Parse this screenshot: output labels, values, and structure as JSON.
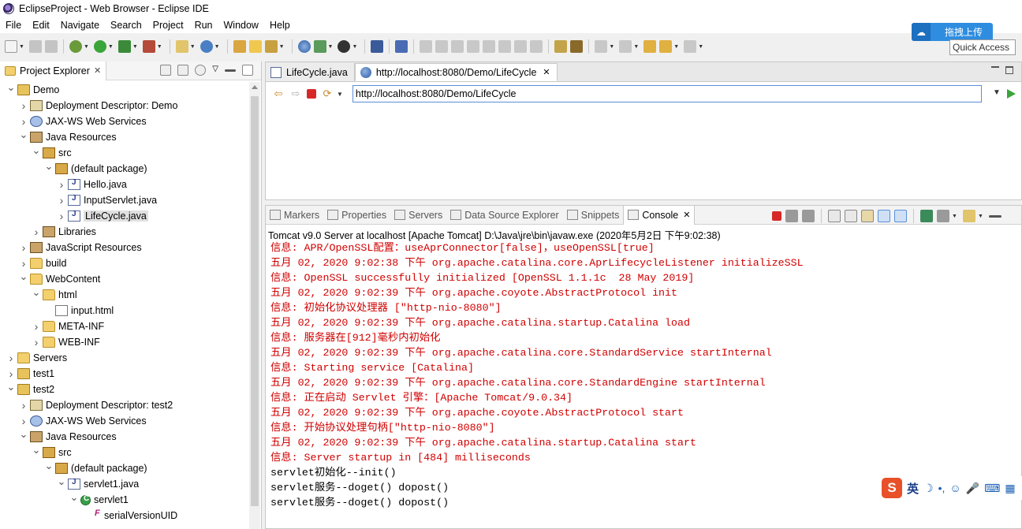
{
  "window": {
    "title": "EclipseProject - Web Browser - Eclipse IDE"
  },
  "menu": [
    "File",
    "Edit",
    "Navigate",
    "Search",
    "Project",
    "Run",
    "Window",
    "Help"
  ],
  "upload": {
    "label": "拖拽上传"
  },
  "quick_access": {
    "label": "Quick Access"
  },
  "project_explorer": {
    "tab_label": "Project Explorer",
    "items": [
      {
        "label": "Demo",
        "depth": 0,
        "arrow": "open",
        "icon": "project"
      },
      {
        "label": "Deployment Descriptor: Demo",
        "depth": 1,
        "arrow": "closed",
        "icon": "dd"
      },
      {
        "label": "JAX-WS Web Services",
        "depth": 1,
        "arrow": "closed",
        "icon": "ws"
      },
      {
        "label": "Java Resources",
        "depth": 1,
        "arrow": "open",
        "icon": "lib"
      },
      {
        "label": "src",
        "depth": 2,
        "arrow": "open",
        "icon": "package"
      },
      {
        "label": "(default package)",
        "depth": 3,
        "arrow": "open",
        "icon": "package"
      },
      {
        "label": "Hello.java",
        "depth": 4,
        "arrow": "closed",
        "icon": "java"
      },
      {
        "label": "InputServlet.java",
        "depth": 4,
        "arrow": "closed",
        "icon": "java"
      },
      {
        "label": "LifeCycle.java",
        "depth": 4,
        "arrow": "closed",
        "icon": "java",
        "selected": true
      },
      {
        "label": "Libraries",
        "depth": 2,
        "arrow": "closed",
        "icon": "lib"
      },
      {
        "label": "JavaScript Resources",
        "depth": 1,
        "arrow": "closed",
        "icon": "lib"
      },
      {
        "label": "build",
        "depth": 1,
        "arrow": "closed",
        "icon": "folder"
      },
      {
        "label": "WebContent",
        "depth": 1,
        "arrow": "open",
        "icon": "folder"
      },
      {
        "label": "html",
        "depth": 2,
        "arrow": "open",
        "icon": "folder"
      },
      {
        "label": "input.html",
        "depth": 3,
        "arrow": "none",
        "icon": "html"
      },
      {
        "label": "META-INF",
        "depth": 2,
        "arrow": "closed",
        "icon": "folder"
      },
      {
        "label": "WEB-INF",
        "depth": 2,
        "arrow": "closed",
        "icon": "folder"
      },
      {
        "label": "Servers",
        "depth": 0,
        "arrow": "closed",
        "icon": "folder"
      },
      {
        "label": "test1",
        "depth": 0,
        "arrow": "closed",
        "icon": "project"
      },
      {
        "label": "test2",
        "depth": 0,
        "arrow": "open",
        "icon": "project"
      },
      {
        "label": "Deployment Descriptor: test2",
        "depth": 1,
        "arrow": "closed",
        "icon": "dd"
      },
      {
        "label": "JAX-WS Web Services",
        "depth": 1,
        "arrow": "closed",
        "icon": "ws"
      },
      {
        "label": "Java Resources",
        "depth": 1,
        "arrow": "open",
        "icon": "lib"
      },
      {
        "label": "src",
        "depth": 2,
        "arrow": "open",
        "icon": "package"
      },
      {
        "label": "(default package)",
        "depth": 3,
        "arrow": "open",
        "icon": "package"
      },
      {
        "label": "servlet1.java",
        "depth": 4,
        "arrow": "open",
        "icon": "java"
      },
      {
        "label": "servlet1",
        "depth": 5,
        "arrow": "open",
        "icon": "classc"
      },
      {
        "label": "serialVersionUID",
        "depth": 6,
        "arrow": "none",
        "icon": "field"
      }
    ]
  },
  "editor": {
    "tabs": [
      {
        "label": "LifeCycle.java",
        "icon": "jfile",
        "active": false
      },
      {
        "label": "http://localhost:8080/Demo/LifeCycle",
        "icon": "globe",
        "active": true
      }
    ],
    "url": "http://localhost:8080/Demo/LifeCycle"
  },
  "console": {
    "tabs": [
      {
        "label": "Markers",
        "active": false
      },
      {
        "label": "Properties",
        "active": false
      },
      {
        "label": "Servers",
        "active": false
      },
      {
        "label": "Data Source Explorer",
        "active": false
      },
      {
        "label": "Snippets",
        "active": false
      },
      {
        "label": "Console",
        "active": true
      }
    ],
    "description": "Tomcat v9.0 Server at localhost [Apache Tomcat] D:\\Java\\jre\\bin\\javaw.exe (2020年5月2日 下午9:02:38)",
    "lines": [
      {
        "text": "信息: APR/OpenSSL配置：useAprConnector[false]，useOpenSSL[true]",
        "kind": "err"
      },
      {
        "text": "五月 02, 2020 9:02:38 下午 org.apache.catalina.core.AprLifecycleListener initializeSSL",
        "kind": "err"
      },
      {
        "text": "信息: OpenSSL successfully initialized [OpenSSL 1.1.1c  28 May 2019]",
        "kind": "err"
      },
      {
        "text": "五月 02, 2020 9:02:39 下午 org.apache.coyote.AbstractProtocol init",
        "kind": "err"
      },
      {
        "text": "信息: 初始化协议处理器 [\"http-nio-8080\"]",
        "kind": "err"
      },
      {
        "text": "五月 02, 2020 9:02:39 下午 org.apache.catalina.startup.Catalina load",
        "kind": "err"
      },
      {
        "text": "信息: 服务器在[912]毫秒内初始化",
        "kind": "err"
      },
      {
        "text": "五月 02, 2020 9:02:39 下午 org.apache.catalina.core.StandardService startInternal",
        "kind": "err"
      },
      {
        "text": "信息: Starting service [Catalina]",
        "kind": "err"
      },
      {
        "text": "五月 02, 2020 9:02:39 下午 org.apache.catalina.core.StandardEngine startInternal",
        "kind": "err"
      },
      {
        "text": "信息: 正在启动 Servlet 引擎：[Apache Tomcat/9.0.34]",
        "kind": "err"
      },
      {
        "text": "五月 02, 2020 9:02:39 下午 org.apache.coyote.AbstractProtocol start",
        "kind": "err"
      },
      {
        "text": "信息: 开始协议处理句柄[\"http-nio-8080\"]",
        "kind": "err"
      },
      {
        "text": "五月 02, 2020 9:02:39 下午 org.apache.catalina.startup.Catalina start",
        "kind": "err"
      },
      {
        "text": "信息: Server startup in [484] milliseconds",
        "kind": "err"
      },
      {
        "text": "servlet初始化--init()",
        "kind": "out"
      },
      {
        "text": "servlet服务--doget() dopost()",
        "kind": "out"
      },
      {
        "text": "servlet服务--doget() dopost()",
        "kind": "out"
      }
    ]
  },
  "ime": {
    "lang": "英"
  },
  "colors": {
    "error_text": "#d00000",
    "accent_blue": "#2f8de0",
    "run_green": "#3aa53a"
  }
}
